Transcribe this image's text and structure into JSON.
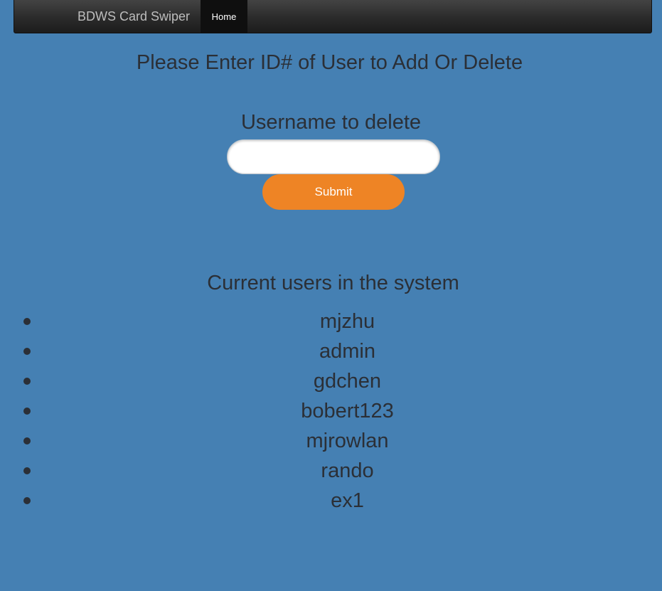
{
  "navbar": {
    "brand": "BDWS Card Swiper",
    "home_label": "Home"
  },
  "main": {
    "title": "Please Enter ID# of User to Add Or Delete",
    "delete_form": {
      "label": "Username to delete",
      "input_value": "",
      "submit_label": "Submit"
    },
    "users_title": "Current users in the system",
    "users": [
      "mjzhu",
      "admin",
      "gdchen",
      "bobert123",
      "mjrowlan",
      "rando",
      "ex1"
    ]
  },
  "colors": {
    "background": "#4580b3",
    "submit_button": "#ee8425",
    "navbar": "#2b2b2b",
    "text": "#2b2f36"
  }
}
